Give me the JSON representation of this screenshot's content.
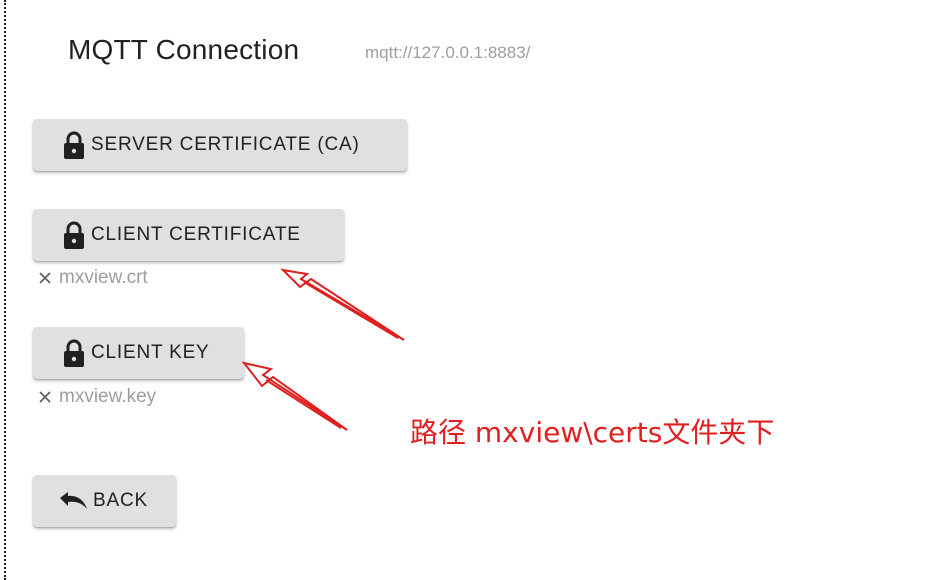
{
  "header": {
    "title": "MQTT Connection",
    "url": "mqtt://127.0.0.1:8883/"
  },
  "buttons": {
    "server_ca": {
      "label": "SERVER CERTIFICATE (CA)",
      "icon": "lock-icon"
    },
    "client_cert": {
      "label": "CLIENT CERTIFICATE",
      "icon": "lock-icon"
    },
    "client_key": {
      "label": "CLIENT KEY",
      "icon": "lock-icon"
    },
    "back": {
      "label": "BACK",
      "icon": "undo-icon"
    }
  },
  "files": {
    "client_cert": "mxview.crt",
    "client_key": "mxview.key"
  },
  "annotation": {
    "text": "路径 mxview\\certs文件夹下",
    "color": "#e02020"
  },
  "colors": {
    "button_bg": "#e0e0e0",
    "muted_text": "#9e9e9e",
    "annotation": "#e02020"
  }
}
